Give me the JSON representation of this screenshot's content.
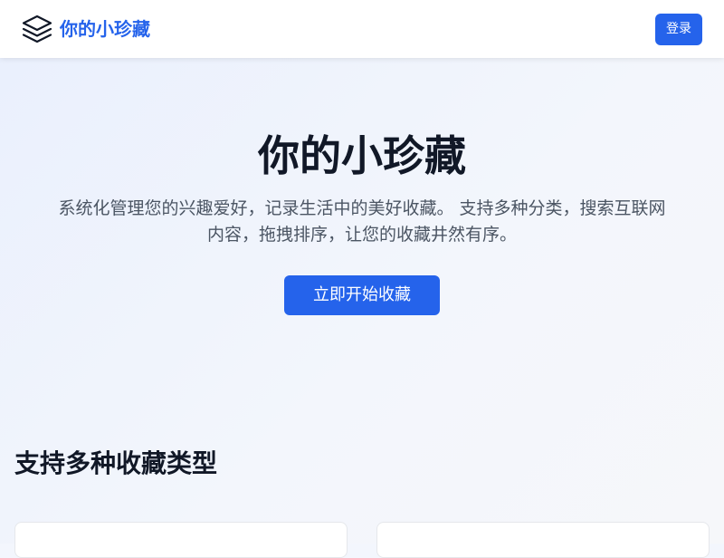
{
  "header": {
    "logo_icon": "stacked-layers-icon",
    "brand_name": "你的小珍藏",
    "login_label": "登录"
  },
  "hero": {
    "title": "你的小珍藏",
    "description": "系统化管理您的兴趣爱好，记录生活中的美好收藏。 支持多种分类，搜索互联网内容，拖拽排序，让您的收藏井然有序。",
    "cta_label": "立即开始收藏"
  },
  "features": {
    "section_title": "支持多种收藏类型"
  },
  "colors": {
    "accent": "#2563eb",
    "heading": "#111827",
    "body_text": "#4b5563",
    "hero_bg": "#eef2fb"
  }
}
